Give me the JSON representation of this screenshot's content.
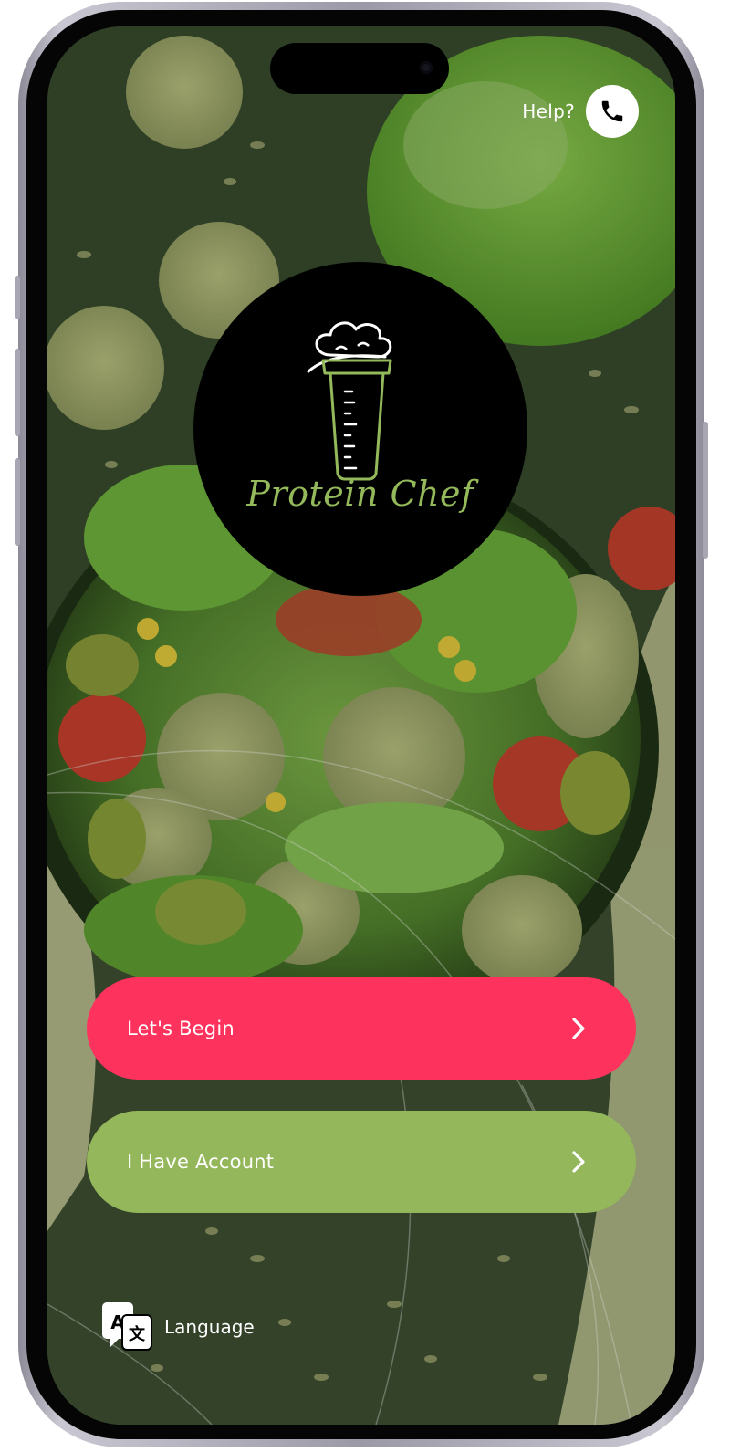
{
  "header": {
    "help_label": "Help?",
    "help_icon": "phone-icon"
  },
  "brand": {
    "name": "Protein Chef",
    "logo_icon": "chef-hat-shaker-icon",
    "accent_color": "#94b95a"
  },
  "actions": {
    "begin_label": "Let's Begin",
    "begin_color": "#fe335d",
    "account_label": "I Have Account",
    "account_color": "#93b75a",
    "arrow_icon": "chevron-right-icon"
  },
  "footer": {
    "language_label": "Language",
    "language_icon": "translate-icon"
  }
}
